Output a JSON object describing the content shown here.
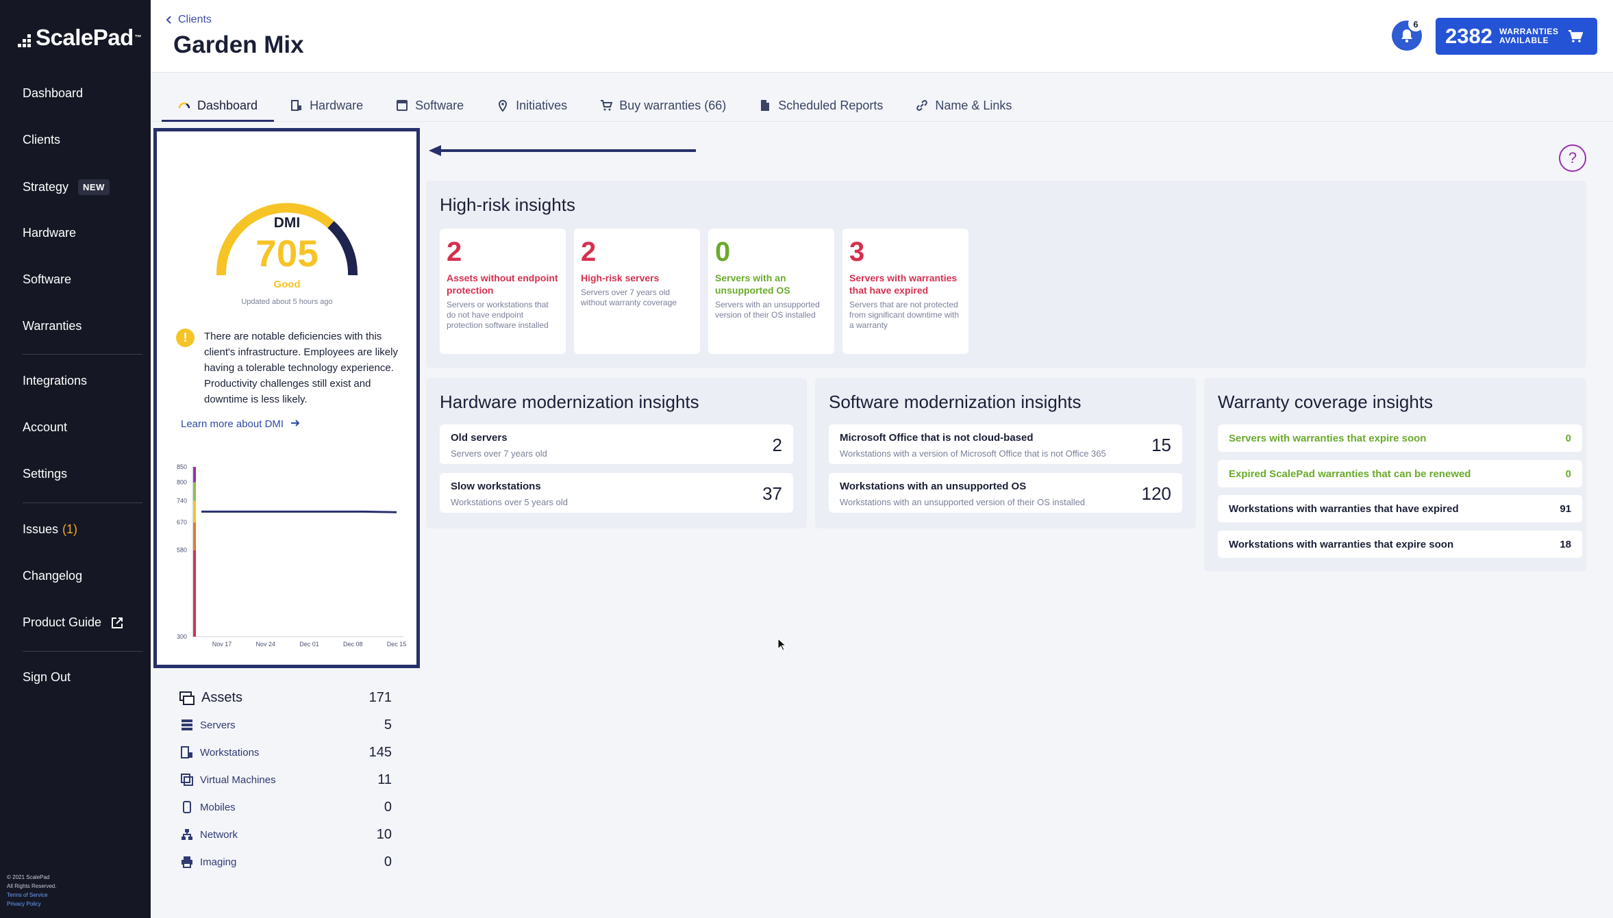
{
  "brand": {
    "name": "ScalePad",
    "tm": "™"
  },
  "sidebar": {
    "items": [
      {
        "label": "Dashboard"
      },
      {
        "label": "Clients"
      },
      {
        "label": "Strategy",
        "badge": "NEW"
      },
      {
        "label": "Hardware"
      },
      {
        "label": "Software"
      },
      {
        "label": "Warranties"
      },
      {
        "label": "Integrations"
      },
      {
        "label": "Account"
      },
      {
        "label": "Settings"
      },
      {
        "label": "Issues",
        "count": "(1)"
      },
      {
        "label": "Changelog"
      },
      {
        "label": "Product Guide"
      },
      {
        "label": "Sign Out"
      }
    ],
    "footer": {
      "copyright": "© 2021 ScalePad",
      "rights": "All Rights Reserved.",
      "terms": "Terms of Service",
      "privacy": "Privacy Policy"
    }
  },
  "header": {
    "breadcrumb": "Clients",
    "title": "Garden Mix",
    "notifications": "6",
    "warranties_count": "2382",
    "warranties_label": "WARRANTIES AVAILABLE"
  },
  "tabs": [
    {
      "label": "Dashboard",
      "icon": "gauge-icon"
    },
    {
      "label": "Hardware",
      "icon": "workstation-icon"
    },
    {
      "label": "Software",
      "icon": "window-icon"
    },
    {
      "label": "Initiatives",
      "icon": "pin-icon"
    },
    {
      "label": "Buy warranties (66)",
      "icon": "cart-icon"
    },
    {
      "label": "Scheduled Reports",
      "icon": "document-icon"
    },
    {
      "label": "Name & Links",
      "icon": "link-icon"
    }
  ],
  "dmi": {
    "label": "DMI",
    "score": "705",
    "rating": "Good",
    "updated": "Updated about 5 hours ago",
    "description": "There are notable deficiencies with this client's infrastructure. Employees are likely having a tolerable technology experience. Productivity challenges still exist and downtime is less likely.",
    "learn_more": "Learn more about DMI"
  },
  "chart_data": {
    "type": "line",
    "yticks": [
      "850",
      "800",
      "740",
      "670",
      "580",
      "300"
    ],
    "xticks": [
      "Nov 17",
      "Nov 24",
      "Dec 01",
      "Dec 08",
      "Dec 15"
    ],
    "series": [
      {
        "values": [
          705,
          705,
          705,
          705,
          705,
          705,
          703
        ]
      }
    ],
    "ylim": [
      300,
      850
    ]
  },
  "high_risk": {
    "title": "High-risk insights",
    "cards": [
      {
        "value": "2",
        "title": "Assets without endpoint protection",
        "desc": "Servers or workstations that do not have endpoint protection software installed",
        "tone": "red"
      },
      {
        "value": "2",
        "title": "High-risk servers",
        "desc": "Servers over 7 years old without warranty coverage",
        "tone": "red"
      },
      {
        "value": "0",
        "title": "Servers with an unsupported OS",
        "desc": "Servers with an unsupported version of their OS installed",
        "tone": "green"
      },
      {
        "value": "3",
        "title": "Servers with warranties that have expired",
        "desc": "Servers that are not protected from significant downtime with a warranty",
        "tone": "red"
      }
    ]
  },
  "hardware": {
    "title": "Hardware modernization insights",
    "rows": [
      {
        "title": "Old servers",
        "desc": "Servers over 7 years old",
        "value": "2"
      },
      {
        "title": "Slow workstations",
        "desc": "Workstations over 5 years old",
        "value": "37"
      }
    ]
  },
  "software": {
    "title": "Software modernization insights",
    "rows": [
      {
        "title": "Microsoft Office that is not cloud-based",
        "desc": "Workstations with a version of Microsoft Office that is not Office 365",
        "value": "15"
      },
      {
        "title": "Workstations with an unsupported OS",
        "desc": "Workstations with an unsupported version of their OS installed",
        "value": "120"
      }
    ]
  },
  "warranty": {
    "title": "Warranty coverage insights",
    "rows": [
      {
        "title": "Servers with warranties that expire soon",
        "value": "0",
        "tone": "green"
      },
      {
        "title": "Expired ScalePad warranties that can be renewed",
        "value": "0",
        "tone": "green"
      },
      {
        "title": "Workstations with warranties that have expired",
        "value": "91",
        "tone": "default"
      },
      {
        "title": "Workstations with warranties that expire soon",
        "value": "18",
        "tone": "default"
      }
    ]
  },
  "assets": {
    "title": "Assets",
    "total": "171",
    "rows": [
      {
        "label": "Servers",
        "value": "5"
      },
      {
        "label": "Workstations",
        "value": "145"
      },
      {
        "label": "Virtual Machines",
        "value": "11"
      },
      {
        "label": "Mobiles",
        "value": "0"
      },
      {
        "label": "Network",
        "value": "10"
      },
      {
        "label": "Imaging",
        "value": "0"
      }
    ]
  },
  "colors": {
    "sidebar_bg": "#151824",
    "accent": "#2453d6",
    "dmi_yellow": "#f6c427",
    "dmi_navy": "#1e2350",
    "risk_red": "#d5304f",
    "ok_green": "#6aaa2b",
    "help_purple": "#9a2fb0"
  }
}
